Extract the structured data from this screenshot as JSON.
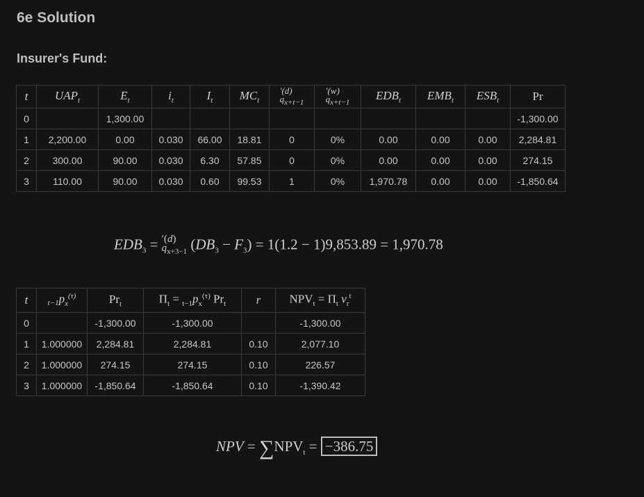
{
  "title": "6e Solution",
  "section": "Insurer's Fund:",
  "table1": {
    "rows": [
      {
        "t": "0",
        "uap": "",
        "e": "1,300.00",
        "i": "",
        "I": "",
        "mc": "",
        "qd": "",
        "qw": "",
        "edb": "",
        "emb": "",
        "esb": "",
        "pr": "-1,300.00"
      },
      {
        "t": "1",
        "uap": "2,200.00",
        "e": "0.00",
        "i": "0.030",
        "I": "66.00",
        "mc": "18.81",
        "qd": "0",
        "qw": "0%",
        "edb": "0.00",
        "emb": "0.00",
        "esb": "0.00",
        "pr": "2,284.81"
      },
      {
        "t": "2",
        "uap": "300.00",
        "e": "90.00",
        "i": "0.030",
        "I": "6.30",
        "mc": "57.85",
        "qd": "0",
        "qw": "0%",
        "edb": "0.00",
        "emb": "0.00",
        "esb": "0.00",
        "pr": "274.15"
      },
      {
        "t": "3",
        "uap": "110.00",
        "e": "90.00",
        "i": "0.030",
        "I": "0.60",
        "mc": "99.53",
        "qd": "1",
        "qw": "0%",
        "edb": "1,970.78",
        "emb": "0.00",
        "esb": "0.00",
        "pr": "-1,850.64"
      }
    ]
  },
  "equation1": {
    "rhs_values": "1(1.2 − 1)9,853.89 = 1,970.78"
  },
  "table2": {
    "rows": [
      {
        "t": "0",
        "p": "",
        "pr": "-1,300.00",
        "pi": "-1,300.00",
        "r": "",
        "npv": "-1,300.00"
      },
      {
        "t": "1",
        "p": "1.000000",
        "pr": "2,284.81",
        "pi": "2,284.81",
        "r": "0.10",
        "npv": "2,077.10"
      },
      {
        "t": "2",
        "p": "1.000000",
        "pr": "274.15",
        "pi": "274.15",
        "r": "0.10",
        "npv": "226.57"
      },
      {
        "t": "3",
        "p": "1.000000",
        "pr": "-1,850.64",
        "pi": "-1,850.64",
        "r": "0.10",
        "npv": "-1,390.42"
      }
    ]
  },
  "equation2": {
    "result": "−386.75"
  }
}
